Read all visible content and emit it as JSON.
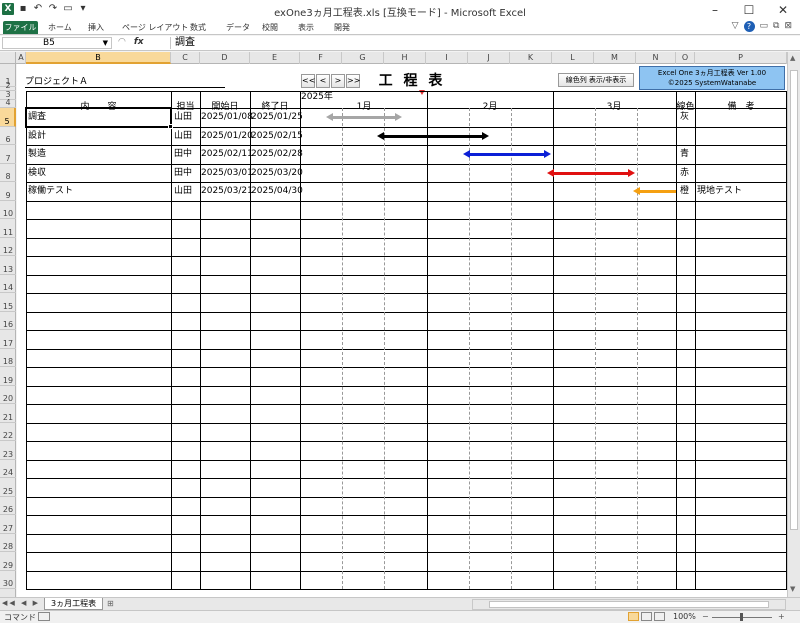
{
  "window": {
    "title": "exOne3ヵ月工程表.xls  [互換モード] - Microsoft Excel",
    "min": "–",
    "max": "☐",
    "close": "✕"
  },
  "ribbon": {
    "file": "ファイル",
    "tabs": [
      "ホーム",
      "挿入",
      "ページ レイアウト",
      "数式",
      "データ",
      "校閲",
      "表示",
      "開発"
    ],
    "right": [
      "▽",
      "?",
      "▭",
      "⧉",
      "⊠"
    ]
  },
  "formula": {
    "name": "B5",
    "value": "調査",
    "fx": "fx"
  },
  "columns": [
    "A",
    "B",
    "C",
    "D",
    "E",
    "F",
    "G",
    "H",
    "I",
    "J",
    "K",
    "L",
    "M",
    "N",
    "O",
    "P"
  ],
  "row_numbers": [
    "1",
    "2",
    "3",
    "4",
    "5",
    "6",
    "7",
    "8",
    "9",
    "10",
    "11",
    "12",
    "13",
    "14",
    "15",
    "16",
    "17",
    "18",
    "19",
    "20",
    "21",
    "22",
    "23",
    "24",
    "25",
    "26",
    "27",
    "28",
    "29",
    "30"
  ],
  "sheet": {
    "project": "プロジェクトＡ",
    "nav": [
      "<<",
      "<",
      ">",
      ">>"
    ],
    "title": "工 程 表",
    "toggle": "線色列 表示/非表示",
    "version_line1": "Excel One 3ヵ月工程表 Ver 1.00",
    "version_line2": "©2025 SystemWatanabe",
    "year": "2025年",
    "months": [
      "1月",
      "2月",
      "3月"
    ],
    "headers": {
      "content": "内　　容",
      "owner": "担当",
      "start": "開始日",
      "end": "終了日",
      "color": "線色",
      "note": "備　考"
    },
    "tasks": [
      {
        "name": "調査",
        "owner": "山田",
        "start": "2025/01/08",
        "end": "2025/01/25",
        "color": "灰",
        "note": "",
        "hex": "#a6a6a6",
        "kind": "both"
      },
      {
        "name": "設計",
        "owner": "山田",
        "start": "2025/01/20",
        "end": "2025/02/15",
        "color": "",
        "note": "",
        "hex": "#000000",
        "kind": "both"
      },
      {
        "name": "製造",
        "owner": "田中",
        "start": "2025/02/11",
        "end": "2025/02/28",
        "color": "青",
        "note": "",
        "hex": "#0b1fd6",
        "kind": "both"
      },
      {
        "name": "検収",
        "owner": "田中",
        "start": "2025/03/01",
        "end": "2025/03/20",
        "color": "赤",
        "note": "",
        "hex": "#e01010",
        "kind": "both"
      },
      {
        "name": "稼働テスト",
        "owner": "山田",
        "start": "2025/03/21",
        "end": "2025/04/30",
        "color": "橙",
        "note": "現地テスト",
        "hex": "#f5a012",
        "kind": "left"
      }
    ]
  },
  "tabs": {
    "sheet": "3ヵ月工程表",
    "navs": "◀◀ ◀ ▶ ▶▶"
  },
  "status": {
    "mode": "コマンド",
    "zoom": "100%",
    "minus": "−",
    "plus": "+"
  }
}
